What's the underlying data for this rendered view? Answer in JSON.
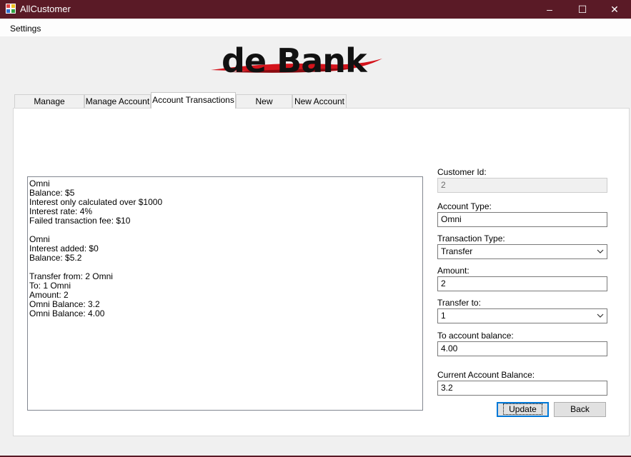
{
  "window": {
    "title": "AllCustomer",
    "minimize_glyph": "–",
    "maximize_glyph": "☐",
    "close_glyph": "✕"
  },
  "menu": {
    "settings": "Settings"
  },
  "logo": {
    "text": "de Bank"
  },
  "tabs": [
    {
      "label": "Manage Customer"
    },
    {
      "label": "Manage Account"
    },
    {
      "label": "Account Transactions"
    },
    {
      "label": "New Customer"
    },
    {
      "label": "New Account"
    }
  ],
  "log_text": "Omni\nBalance: $5\nInterest only calculated over $1000\nInterest rate: 4%\nFailed transaction fee: $10\n\nOmni\nInterest added: $0\nBalance: $5.2\n\nTransfer from: 2 Omni\nTo: 1 Omni\nAmount: 2\nOmni Balance: 3.2\nOmni Balance: 4.00",
  "form": {
    "customer_id_label": "Customer Id:",
    "customer_id_value": "2",
    "account_type_label": "Account Type:",
    "account_type_value": "Omni",
    "transaction_type_label": "Transaction Type:",
    "transaction_type_value": "Transfer",
    "amount_label": "Amount:",
    "amount_value": "2",
    "transfer_to_label": "Transfer to:",
    "transfer_to_value": "1",
    "to_balance_label": "To account balance:",
    "to_balance_value": "4.00",
    "current_balance_label": "Current Account Balance:",
    "current_balance_value": "3.2",
    "update_label": "Update",
    "back_label": "Back"
  },
  "colors": {
    "titlebar": "#5a1a26",
    "accent_focus": "#0078d7",
    "logo_swoosh": "#d4141c"
  }
}
